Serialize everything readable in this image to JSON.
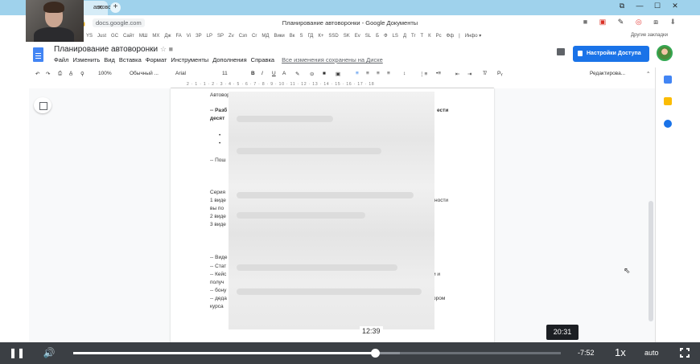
{
  "browser": {
    "tab_title": "автоворо",
    "url": "docs.google.com",
    "window_title": "Планирование автоворонки - Google Документы",
    "bookmarks": [
      "YS",
      "Just",
      "GC",
      "Сайт",
      "МШ",
      "МХ",
      "Дж",
      "FA",
      "Vi",
      "ЗР",
      "LP",
      "SP",
      "Zv",
      "Сзп",
      "Cr",
      "МД",
      "Вики",
      "Вк",
      "S",
      "ГД",
      "К+",
      "SSD",
      "SK",
      "Ev",
      "SL",
      "Б",
      "Ф",
      "LS",
      "Д",
      "Tr",
      "Т",
      "К",
      "Рс",
      "Фф",
      "|",
      "Инфо ▾"
    ],
    "other_bookmarks": "Другие закладки"
  },
  "docs": {
    "title": "Планирование автоворонки",
    "menu": [
      "Файл",
      "Изменить",
      "Вид",
      "Вставка",
      "Формат",
      "Инструменты",
      "Дополнения",
      "Справка"
    ],
    "saved_status": "Все изменения сохранены на Диске",
    "share_label": "Настройки Доступа",
    "toolbar": {
      "zoom": "100%",
      "style": "Обычный ...",
      "font": "Arial",
      "size": "11",
      "mode": "Редактирова..."
    },
    "ruler_ticks": "2 · 1 · 1 · 2 · 3 · 4 · 5 · 6 · 7 · 8 · 9 · 10 · 11 · 12 · 13 · 14 · 15 · 16 · 17 · 18",
    "lines": [
      {
        "text": "Автовор",
        "bold": false
      },
      {
        "text": "-- Разб",
        "bold": true
      },
      {
        "text": "десят",
        "bold": true
      },
      {
        "text": "ести",
        "bold": true
      },
      {
        "text": "•",
        "bold": false
      },
      {
        "text": "•",
        "bold": false
      },
      {
        "text": "-- Пош",
        "bold": false
      },
      {
        "text": "Серия",
        "bold": false
      },
      {
        "text": "1 виде",
        "bold": false
      },
      {
        "text": "ности",
        "bold": false
      },
      {
        "text": "вы по",
        "bold": false
      },
      {
        "text": "2 виде",
        "bold": false
      },
      {
        "text": "3 виде",
        "bold": false
      },
      {
        "text": "-- Виде",
        "bold": false
      },
      {
        "text": "-- Стат",
        "bold": false
      },
      {
        "text": "-- Кейс",
        "bold": false
      },
      {
        "text": "и и",
        "bold": false
      },
      {
        "text": "получ",
        "bold": false
      },
      {
        "text": "-- бону",
        "bold": false
      },
      {
        "text": "-- деда",
        "bold": false
      },
      {
        "text": "ором",
        "bold": false
      },
      {
        "text": "курса",
        "bold": false
      }
    ]
  },
  "player": {
    "hover_time": "12:39",
    "duration_tip": "20:31",
    "remaining": "-7:52",
    "rate": "1x",
    "quality": "auto",
    "played_fraction": 0.618,
    "buffered_fraction": 0.67
  },
  "colors": {
    "tab_bar": "#9fd2ec",
    "share_button": "#1a73e8",
    "player_bar": "#3b3f44"
  }
}
